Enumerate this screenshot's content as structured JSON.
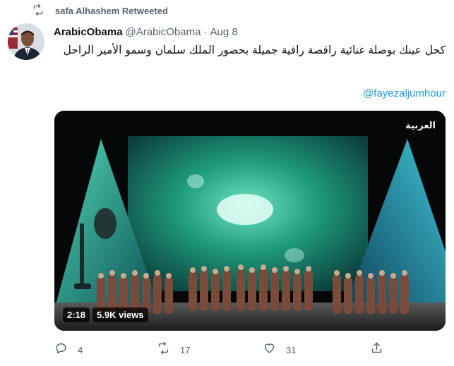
{
  "retweet_banner": {
    "text": "safa Alhashem Retweeted",
    "icon": "retweet-icon"
  },
  "tweet": {
    "display_name": "ArabicObama",
    "handle": "@ArabicObama",
    "separator": "·",
    "date": "Aug 8",
    "text": "كحل عينك بوصلة غنائية راقصة رافية جميلة بحضور الملك سلمان وسمو الأمير الراحل",
    "mention": "@fayezaljumhour",
    "media": {
      "type": "video",
      "channel_logo": "العربية",
      "duration": "2:18",
      "views": "5.9K views"
    },
    "actions": {
      "reply_count": "4",
      "retweet_count": "17",
      "like_count": "31"
    }
  },
  "colors": {
    "text": "#0f1419",
    "secondary": "#536471",
    "link": "#1d9bf0",
    "stage_green": "#2fb38a"
  }
}
